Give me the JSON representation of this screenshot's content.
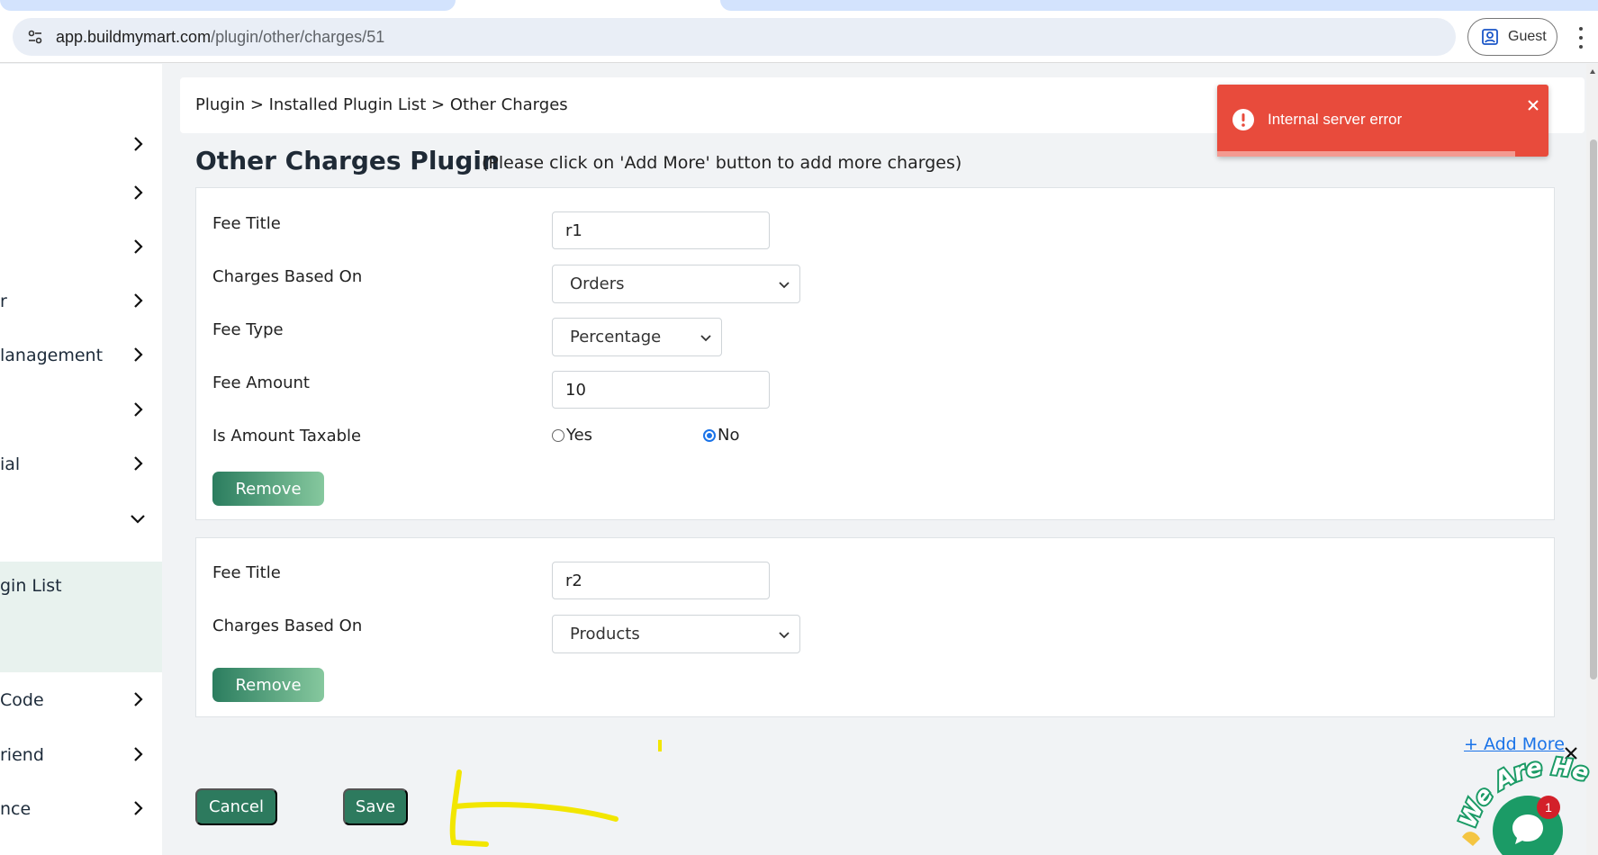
{
  "browser": {
    "url_domain": "app.buildmymart.com",
    "url_path": "/plugin/other/charges/51",
    "profile_label": "Guest"
  },
  "sidebar": {
    "items": [
      {
        "label": "",
        "chevron": "right"
      },
      {
        "label": "",
        "chevron": "right"
      },
      {
        "label": "",
        "chevron": "right"
      },
      {
        "label": "r",
        "chevron": "right"
      },
      {
        "label": "lanagement",
        "chevron": "right"
      },
      {
        "label": "",
        "chevron": "right"
      },
      {
        "label": "ial",
        "chevron": "right"
      },
      {
        "label": "",
        "chevron": "down"
      },
      {
        "label": "gin List",
        "chevron": "none"
      },
      {
        "label": "Code",
        "chevron": "right"
      },
      {
        "label": "riend",
        "chevron": "right"
      },
      {
        "label": "nce",
        "chevron": "right"
      }
    ]
  },
  "breadcrumb": "Plugin > Installed Plugin List > Other Charges",
  "page": {
    "title": "Other Charges Plugin",
    "hint": "(Please click on 'Add More' button to add more charges)"
  },
  "labels": {
    "fee_title": "Fee Title",
    "charges_based_on": "Charges Based On",
    "fee_type": "Fee Type",
    "fee_amount": "Fee Amount",
    "is_amount_taxable": "Is Amount Taxable",
    "yes": "Yes",
    "no": "No",
    "remove": "Remove"
  },
  "charges": [
    {
      "fee_title": "r1",
      "charges_based_on": "Orders",
      "fee_type": "Percentage",
      "fee_amount": "10",
      "taxable": "No"
    },
    {
      "fee_title": "r2",
      "charges_based_on": "Products"
    }
  ],
  "actions": {
    "add_more": "+ Add More",
    "cancel": "Cancel",
    "save": "Save"
  },
  "toast": {
    "message": "Internal server error",
    "progress_fraction": 0.9
  },
  "chat": {
    "badge_count": "1",
    "tagline": "We Are Here!"
  },
  "colors": {
    "accent_green": "#2d7a5e",
    "error_red": "#e84b3c",
    "link_blue": "#1a73e8"
  }
}
